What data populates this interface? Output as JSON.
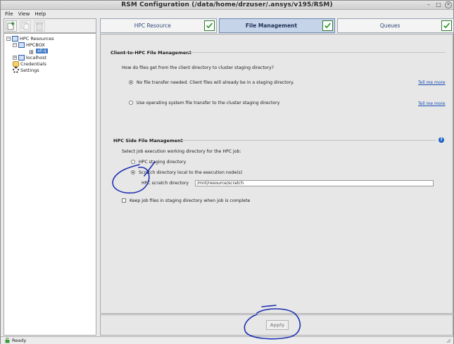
{
  "window": {
    "title": "RSM Configuration (/data/home/drzuser/.ansys/v195/RSM)"
  },
  "menu": {
    "items": [
      "File",
      "View",
      "Help"
    ]
  },
  "tree": {
    "root": "HPC Resources",
    "hpcbox": "HPCBOX",
    "queue": "all.q",
    "localhost": "localhost",
    "credentials": "Credentials",
    "settings": "Settings"
  },
  "tabs": [
    {
      "label": "HPC Resource",
      "active": false
    },
    {
      "label": "File Management",
      "active": true
    },
    {
      "label": "Queues",
      "active": false
    }
  ],
  "client": {
    "title": "Client-to-HPC File Management",
    "question": "How do files get from the client directory to cluster staging directory?",
    "option1": "No file transfer needed.  Client files will already be in a staging directory.",
    "option2": "Use operating system file transfer to the cluster staging directory",
    "tell_me_more": "Tell me more"
  },
  "hpc_side": {
    "title": "HPC Side File Management",
    "question": "Select job execution working directory for the HPC job:",
    "option1": "HPC staging directory",
    "option2": "Scratch directory local to the execution node(s)",
    "scratch_label": "HPC scratch directory",
    "scratch_value": "/mnt/resource/scratch",
    "keep_files": "Keep job files in staging directory when job is complete"
  },
  "apply_label": "Apply",
  "status": {
    "text": "Ready"
  },
  "colors": {
    "annotation": "#1c2fb0",
    "tab_active": "#c6d4ea",
    "check_green": "#2e9b2e",
    "link": "#1a4fb5"
  }
}
